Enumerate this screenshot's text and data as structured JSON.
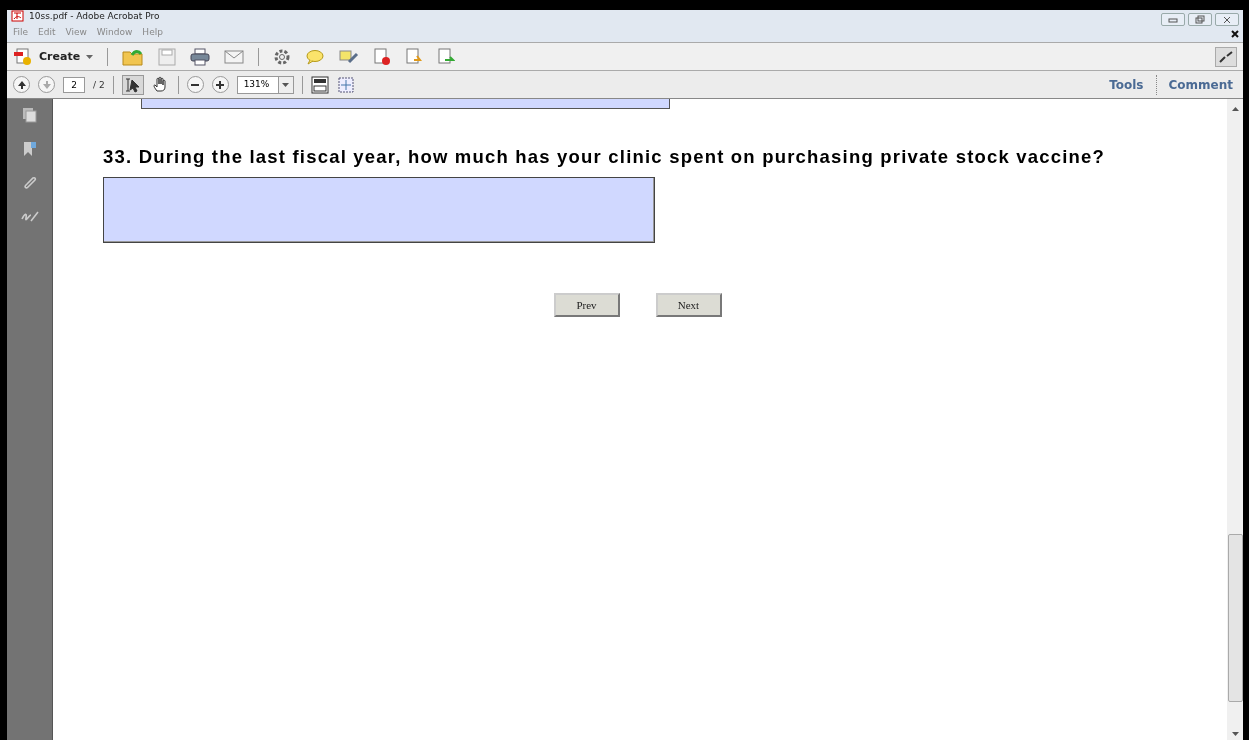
{
  "window": {
    "title": "10ss.pdf - Adobe Acrobat Pro"
  },
  "menu": [
    "File",
    "Edit",
    "View",
    "Window",
    "Help"
  ],
  "toolbar": {
    "create": "Create"
  },
  "nav": {
    "page": "2",
    "page_count": "/ 2",
    "zoom": "131%"
  },
  "panes": [
    "Tools",
    "Comment"
  ],
  "form": {
    "question": "33. During the last fiscal year, how much has your clinic spent on purchasing private stock vaccine?",
    "buttons": [
      "Prev",
      "Next"
    ]
  }
}
